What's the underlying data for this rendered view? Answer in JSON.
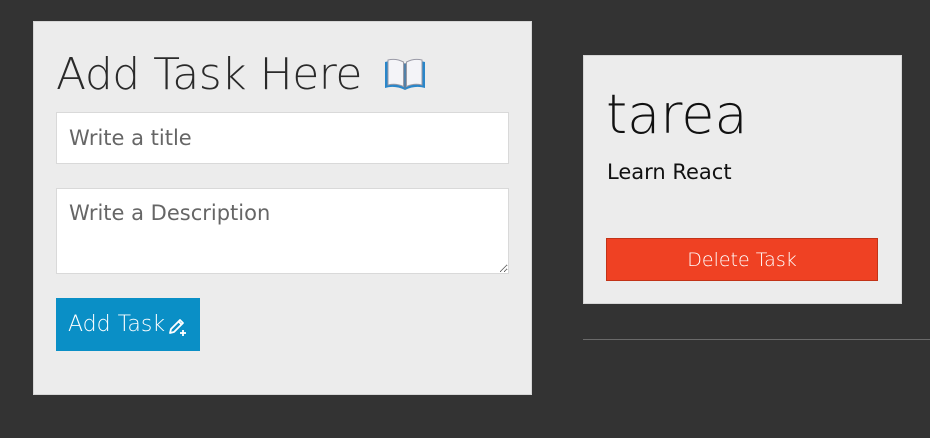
{
  "form": {
    "heading": "Add Task Here",
    "heading_icon": "open-book-icon",
    "title_placeholder": "Write a title",
    "title_value": "",
    "description_placeholder": "Write a Description",
    "description_value": "",
    "add_button_label": "Add Task",
    "add_button_icon": "pencil-plus-icon"
  },
  "tasks": [
    {
      "title": "tarea",
      "description": "Learn React",
      "delete_label": "Delete Task"
    }
  ],
  "colors": {
    "background": "#333333",
    "card": "#ececec",
    "primary": "#0a8fc6",
    "danger": "#ef4123"
  }
}
